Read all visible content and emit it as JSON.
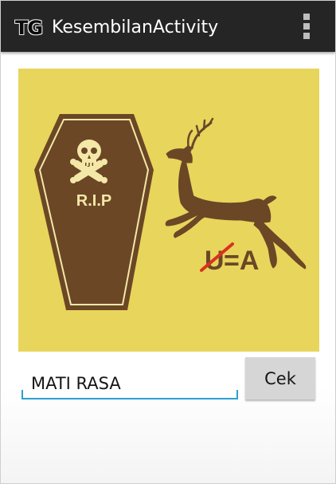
{
  "action_bar": {
    "logo_text": "TG",
    "title": "KesembilanActivity",
    "overflow_icon": "overflow-menu-icon"
  },
  "puzzle_image": {
    "icons": [
      "coffin-icon",
      "skull-crossbones-icon",
      "deer-icon"
    ],
    "coffin_text": "R.I.P",
    "struck_letter": "U",
    "rule_text": "=A",
    "colors": {
      "background": "#e8d55c",
      "brown": "#6b4726",
      "light": "#f3e8a8",
      "strike": "#d8331f"
    }
  },
  "answer": {
    "value": "MATI RASA"
  },
  "check_button": {
    "label": "Cek"
  },
  "colors": {
    "action_bar": "#252525",
    "accent": "#2c9fd1",
    "button": "#d6d6d6"
  }
}
